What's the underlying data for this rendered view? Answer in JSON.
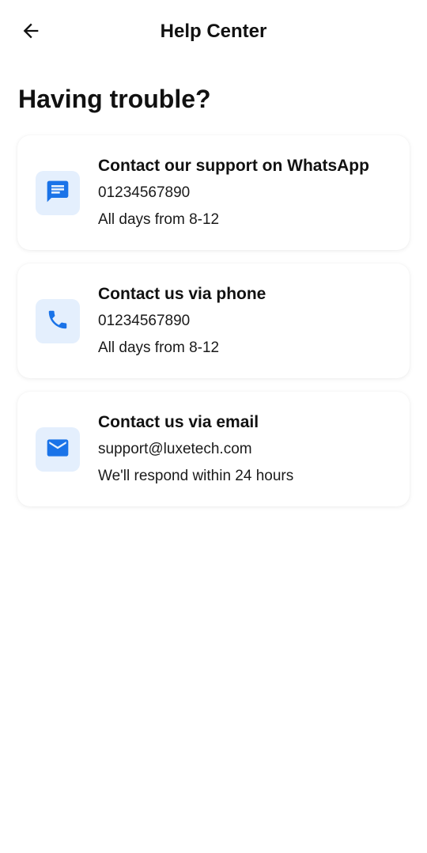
{
  "app_bar": {
    "title": "Help Center",
    "back_icon": "arrow-left-icon"
  },
  "heading": "Having trouble?",
  "colors": {
    "accent": "#1a73e8",
    "icon_tile_bg": "#e4effd",
    "text": "#111111"
  },
  "contacts": [
    {
      "icon": "chat-message-icon",
      "title": "Contact our support on WhatsApp",
      "line1": "01234567890",
      "line2": "All days from 8-12"
    },
    {
      "icon": "phone-icon",
      "title": "Contact us via phone",
      "line1": "01234567890",
      "line2": "All days from 8-12"
    },
    {
      "icon": "email-icon",
      "title": "Contact us via email",
      "line1": "support@luxetech.com",
      "line2": "We'll respond within 24 hours"
    }
  ]
}
